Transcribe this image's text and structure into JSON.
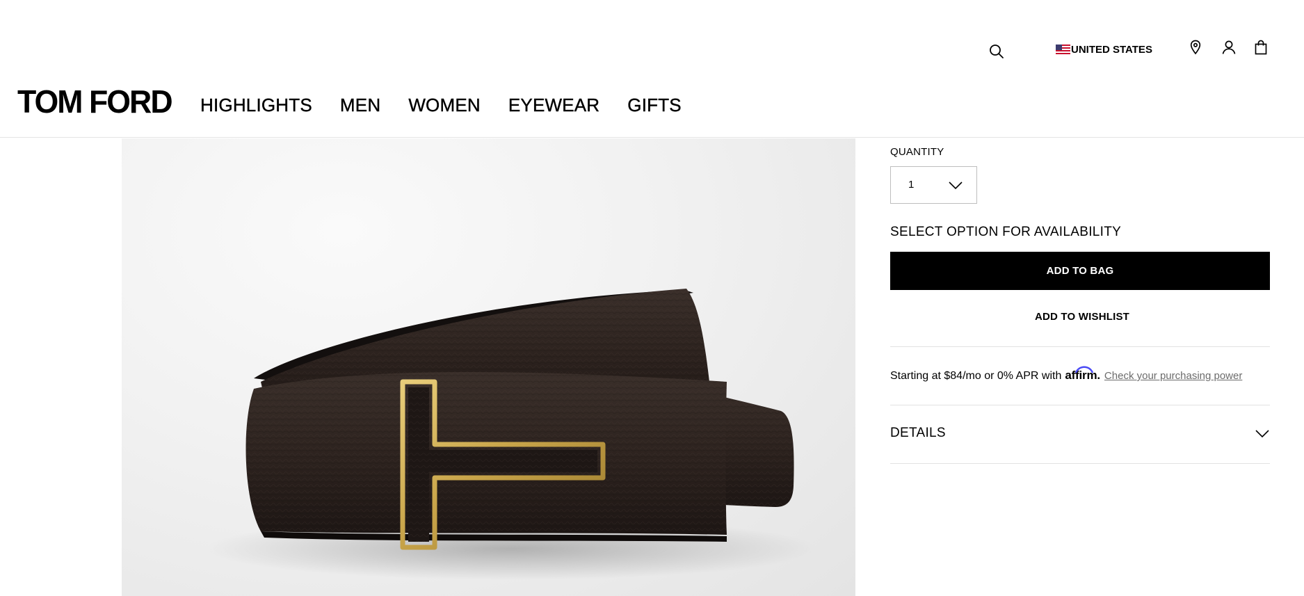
{
  "header": {
    "logo": "TOM FORD",
    "nav": [
      "HIGHLIGHTS",
      "MEN",
      "WOMEN",
      "EYEWEAR",
      "GIFTS"
    ],
    "country": "UNITED STATES",
    "icons": [
      "search-icon",
      "us-flag-icon",
      "store-locator-icon",
      "account-icon",
      "shopping-bag-icon"
    ]
  },
  "product": {
    "image_alt": "Leather T buckle belt",
    "image_colors": {
      "leather": "#2e2420",
      "buckle_gold": "#c9a54a",
      "background": "#ececec"
    }
  },
  "panel": {
    "quantity_label": "QUANTITY",
    "quantity_value": "1",
    "availability_label": "SELECT OPTION FOR AVAILABILITY",
    "add_to_bag_label": "ADD TO BAG",
    "add_to_wishlist_label": "ADD TO WISHLIST",
    "affirm": {
      "text": "Starting at $84/mo or 0% APR with",
      "brand": "affirm",
      "brand_suffix": ".",
      "link": "Check your purchasing power",
      "brand_color": "#4a4af4"
    },
    "details_label": "DETAILS"
  }
}
